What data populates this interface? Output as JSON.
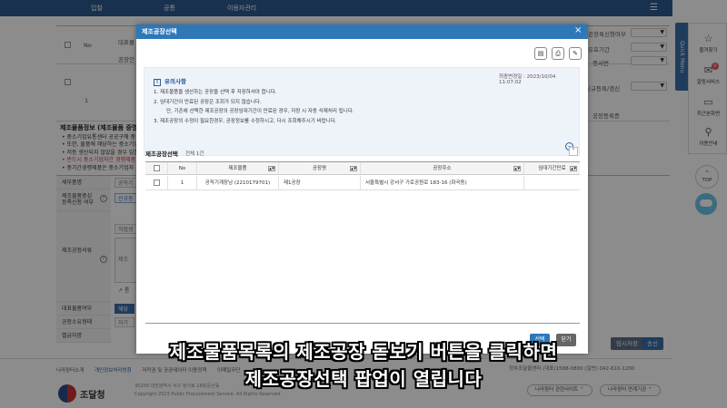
{
  "topnav": {
    "items": [
      "입찰",
      "공통",
      "이용자관리"
    ]
  },
  "background": {
    "table": {
      "no_header": "No",
      "row_no": "1",
      "left_labels": [
        "대표물",
        "공장인"
      ],
      "right_labels": [
        "공장록신청여부",
        "유효기간",
        "증서번",
        "신규등록/갱신",
        "공장등록증"
      ],
      "select_suffix": "▼"
    },
    "section_title": "제조물품정보 (제조물품 중명",
    "bullets": [
      "• 중소기업유통센터 공공구매 중",
      "• 또한, 물품에 해당하는 중소기업",
      "• 저동 생산되지 않았을 경우 입찰",
      "• 반드시 중소기업자간 경쟁제품",
      "• 중기간경쟁제품은 중소기업자"
    ],
    "form_labels": [
      "세부품명",
      "제조물품중심\n등록신청 여부",
      "제조공정서류",
      "대표물품여부",
      "공장소유형태",
      "별급자명"
    ],
    "form_values": [
      "공작기",
      "신규등",
      "직접생",
      "제조",
      "통",
      "해당",
      "자기"
    ],
    "buttons": {
      "temp_save": "임시저장",
      "send": "송신"
    }
  },
  "footer": {
    "links": [
      "나라장터소개",
      "개인정보처리방침",
      "저작권 및 공공데이터 이용정책",
      "이메일무단"
    ],
    "brand": "조달청",
    "address_line1": "35208 대전광역시 서구 청사로 189(둔산동",
    "address_line2": "Copyright 2023 Public Procurement Service. All Rights Reserved.",
    "contact": "정부조달콜센터 (대표)1588-0800 (일반) 042-610-1200",
    "related_sites": "나라장터 관련사이트 ⌃",
    "linked_orgs": "나라장터 연계기관 ⌃"
  },
  "quick_menu": {
    "tab_label": "Quick Menu",
    "items": [
      {
        "label": "즐겨찾기",
        "icon": "star-icon"
      },
      {
        "label": "알림서비스",
        "icon": "bell-icon",
        "badge": "0"
      },
      {
        "label": "최근본화면",
        "icon": "monitor-icon"
      },
      {
        "label": "이용안내",
        "icon": "guide-icon"
      }
    ],
    "top_label": "TOP"
  },
  "modal": {
    "title": "제조공장선택",
    "notice": {
      "title": "유의사항",
      "title_icon": "!",
      "updated": "최종변경일 : 2023/10/04 11:07:02",
      "lines": [
        "1. 제조물품을 생산하는 공장을 선택 후 저장하셔야 합니다.",
        "2. 임대기간이 만료된 공장은 조회가 되지 않습니다.",
        "단, 기존에 선택한 제조공장의 공장임대기간이 만료된 경우, 저장 시 자동 삭제처리 됩니다.",
        "3. 제조공장의 수정이 필요한경우, 공장정보를 수정하시고, 다시 조회해주시기 바랍니다."
      ]
    },
    "section": {
      "title": "제조공장선택",
      "count": "전체 1건"
    },
    "grid": {
      "headers": [
        "No",
        "제조물품",
        "공장명",
        "공장주소",
        "임대기간만료"
      ],
      "sort_glyph": "▲▼",
      "rows": [
        {
          "no": "1",
          "product": "공작기계장남 (2210179701)",
          "factory": "제1공장",
          "address": "서울특별시 강서구 가로공원로 183-16 (화곡동)",
          "expiry": ""
        }
      ]
    },
    "buttons": {
      "select": "선택",
      "close": "닫기"
    }
  },
  "caption": {
    "line1": "제조물품목록의 제조공장 돋보기 버튼을 클릭하면",
    "line2": "제조공장선택 팝업이 열립니다"
  },
  "colors": {
    "nav": "#2d5a8e",
    "modal_header": "#2e78b8",
    "send_button": "#3a6ea8"
  }
}
